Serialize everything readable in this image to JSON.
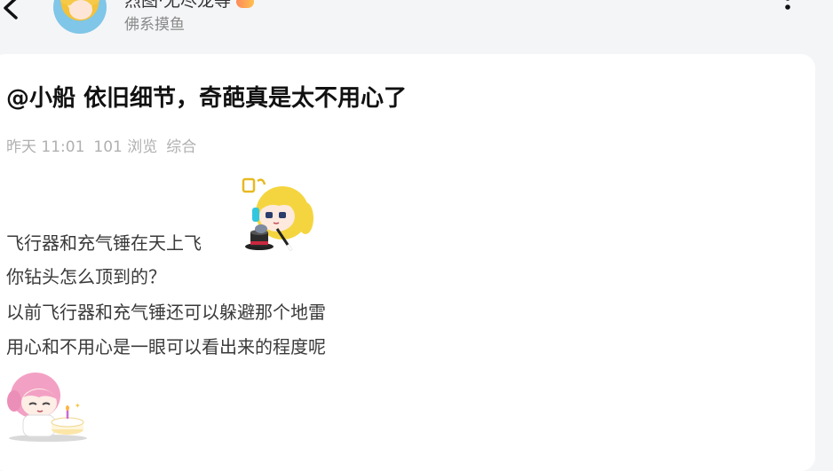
{
  "header": {
    "username": "烈图·无尽龙等",
    "group": "佛系摸鱼"
  },
  "post": {
    "title": "@小船 依旧细节，奇葩真是太不用心了",
    "meta": {
      "time": "昨天 11:01",
      "views": "101 浏览",
      "category": "综合"
    },
    "lines": [
      "飞行器和充气锤在天上飞",
      "你钻头怎么顶到的？",
      "以前飞行器和充气锤还可以躲避那个地雷",
      "用心和不用心是一眼可以看出来的程度呢"
    ]
  },
  "icons": {
    "back": "chevron-left-icon",
    "more": "more-vertical-icon",
    "sticker1": "anime-girl-magic-hat-sticker",
    "sticker2": "anime-girl-cake-sticker"
  }
}
